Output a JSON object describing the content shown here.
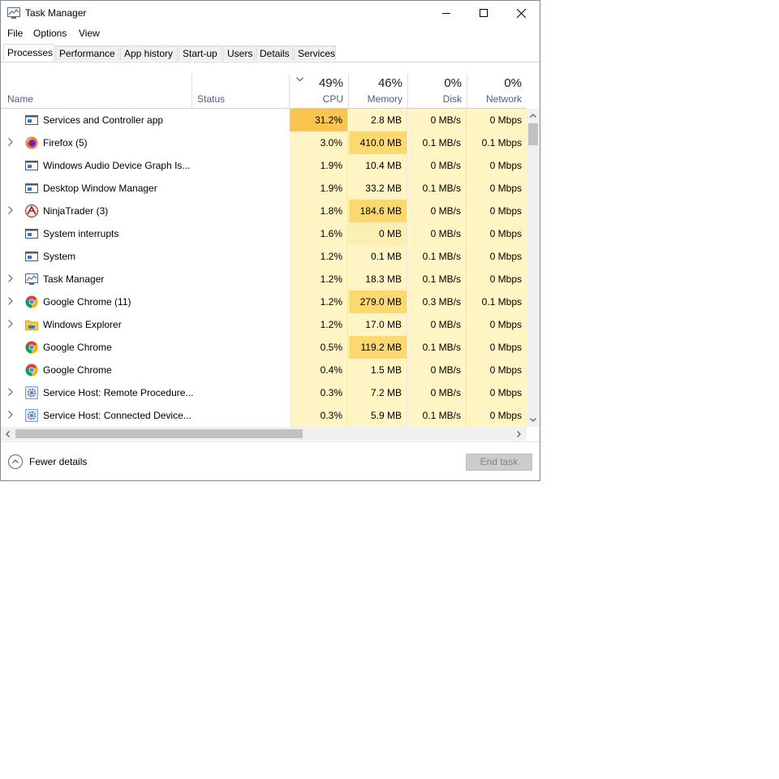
{
  "window": {
    "title": "Task Manager",
    "minimize_icon": "minimize-icon",
    "maximize_icon": "maximize-icon",
    "close_icon": "close-icon"
  },
  "menu": [
    "File",
    "Options",
    "View"
  ],
  "tabs": [
    {
      "label": "Processes",
      "active": true
    },
    {
      "label": "Performance",
      "active": false
    },
    {
      "label": "App history",
      "active": false
    },
    {
      "label": "Start-up",
      "active": false
    },
    {
      "label": "Users",
      "active": false
    },
    {
      "label": "Details",
      "active": false
    },
    {
      "label": "Services",
      "active": false
    }
  ],
  "columns": {
    "name": {
      "label": "Name"
    },
    "status": {
      "label": "Status"
    },
    "cpu": {
      "pct": "49%",
      "label": "CPU",
      "sorted": true
    },
    "memory": {
      "pct": "46%",
      "label": "Memory"
    },
    "disk": {
      "pct": "0%",
      "label": "Disk"
    },
    "network": {
      "pct": "0%",
      "label": "Network"
    }
  },
  "processes": [
    {
      "name": "Services and Controller app",
      "icon": "service-app-icon",
      "expandable": false,
      "cpu": "31.2%",
      "memory": "2.8 MB",
      "disk": "0 MB/s",
      "network": "0 Mbps"
    },
    {
      "name": "Firefox (5)",
      "icon": "firefox-icon",
      "expandable": true,
      "cpu": "3.0%",
      "memory": "410.0 MB",
      "disk": "0.1 MB/s",
      "network": "0.1 Mbps"
    },
    {
      "name": "Windows Audio Device Graph Is...",
      "icon": "service-app-icon",
      "expandable": false,
      "cpu": "1.9%",
      "memory": "10.4 MB",
      "disk": "0 MB/s",
      "network": "0 Mbps"
    },
    {
      "name": "Desktop Window Manager",
      "icon": "service-app-icon",
      "expandable": false,
      "cpu": "1.9%",
      "memory": "33.2 MB",
      "disk": "0.1 MB/s",
      "network": "0 Mbps"
    },
    {
      "name": "NinjaTrader (3)",
      "icon": "ninjatrader-icon",
      "expandable": true,
      "cpu": "1.8%",
      "memory": "184.6 MB",
      "disk": "0 MB/s",
      "network": "0 Mbps"
    },
    {
      "name": "System interrupts",
      "icon": "service-app-icon",
      "expandable": false,
      "cpu": "1.6%",
      "memory": "0 MB",
      "disk": "0 MB/s",
      "network": "0 Mbps"
    },
    {
      "name": "System",
      "icon": "service-app-icon",
      "expandable": false,
      "cpu": "1.2%",
      "memory": "0.1 MB",
      "disk": "0.1 MB/s",
      "network": "0 Mbps"
    },
    {
      "name": "Task Manager",
      "icon": "task-manager-icon",
      "expandable": true,
      "cpu": "1.2%",
      "memory": "18.3 MB",
      "disk": "0.1 MB/s",
      "network": "0 Mbps"
    },
    {
      "name": "Google Chrome (11)",
      "icon": "chrome-icon",
      "expandable": true,
      "cpu": "1.2%",
      "memory": "279.0 MB",
      "disk": "0.3 MB/s",
      "network": "0.1 Mbps"
    },
    {
      "name": "Windows Explorer",
      "icon": "folder-icon",
      "expandable": true,
      "cpu": "1.2%",
      "memory": "17.0 MB",
      "disk": "0 MB/s",
      "network": "0 Mbps"
    },
    {
      "name": "Google Chrome",
      "icon": "chrome-icon",
      "expandable": false,
      "cpu": "0.5%",
      "memory": "119.2 MB",
      "disk": "0.1 MB/s",
      "network": "0 Mbps"
    },
    {
      "name": "Google Chrome",
      "icon": "chrome-icon",
      "expandable": false,
      "cpu": "0.4%",
      "memory": "1.5 MB",
      "disk": "0 MB/s",
      "network": "0 Mbps"
    },
    {
      "name": "Service Host: Remote Procedure...",
      "icon": "gear-icon",
      "expandable": true,
      "cpu": "0.3%",
      "memory": "7.2 MB",
      "disk": "0 MB/s",
      "network": "0 Mbps"
    },
    {
      "name": "Service Host: Connected Device...",
      "icon": "gear-icon",
      "expandable": true,
      "cpu": "0.3%",
      "memory": "5.9 MB",
      "disk": "0.1 MB/s",
      "network": "0 Mbps"
    }
  ],
  "footer": {
    "fewer_details": "Fewer details",
    "end_task": "End task"
  },
  "colors": {
    "heat_high": "#f9c44f",
    "heat_med": "#fcd970",
    "heat_low": "#fcefb3",
    "heat_base": "#fff4c4",
    "accent_text": "#4d6082"
  }
}
